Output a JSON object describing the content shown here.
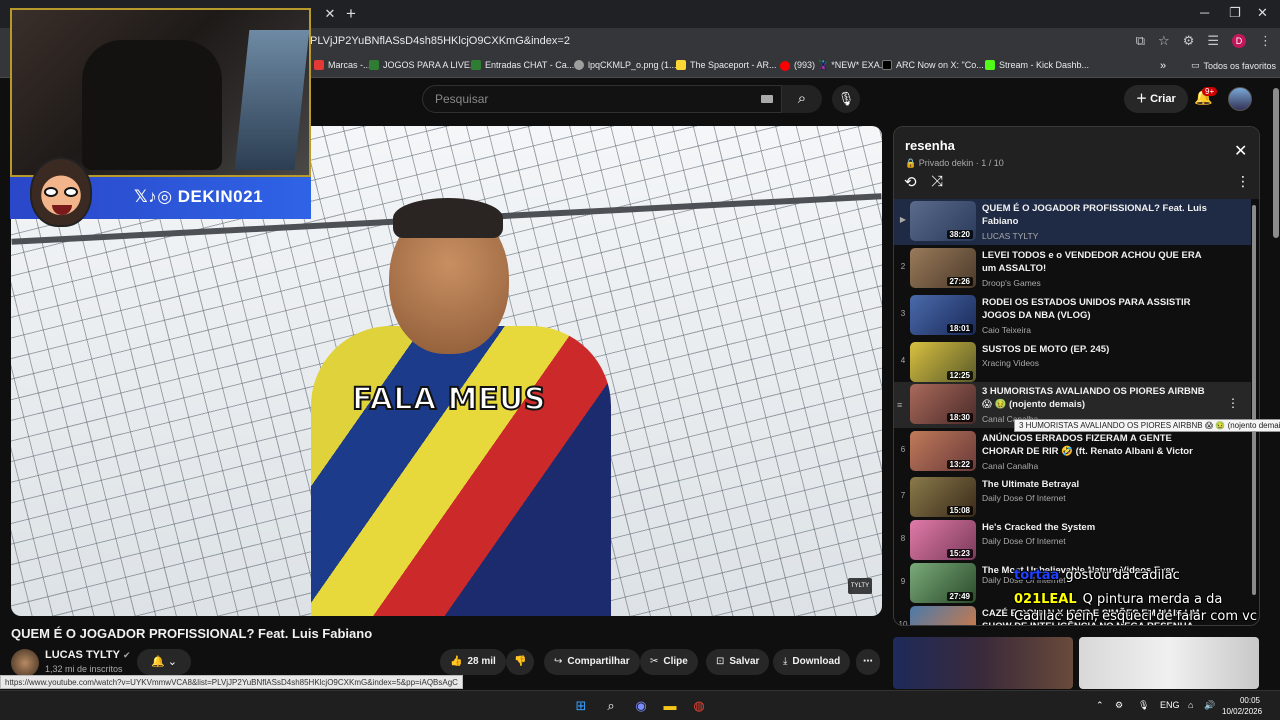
{
  "browser": {
    "url": "PLVjJP2YuBNflASsD4sh85HKlcjO9CXKmG&index=2",
    "bookmarks": [
      {
        "label": "Marcas -...",
        "color": "#e53935"
      },
      {
        "label": "JOGOS PARA A LIVE...",
        "color": "#2e7d32"
      },
      {
        "label": "Entradas CHAT - Ca...",
        "color": "#2e7d32"
      },
      {
        "label": "lpqCKMLP_o.png (1...",
        "color": "#9e9e9e"
      },
      {
        "label": "The Spaceport - AR...",
        "color": "#fdd835"
      },
      {
        "label": "(993) 🦹 *NEW* EXA...",
        "color": "#ff0000"
      },
      {
        "label": "ARC Now on X: \"Co...",
        "color": "#000000"
      },
      {
        "label": "Stream - Kick Dashb...",
        "color": "#53fc18"
      }
    ],
    "all_bookmarks": "Todos os favoritos",
    "profile_initial": "D",
    "status_url": "https://www.youtube.com/watch?v=UYKVmmwVCA8&list=PLVjJP2YuBNflASsD4sh85HKlcjO9CXKmG&index=5&pp=iAQBsAgC"
  },
  "youtube_header": {
    "search_placeholder": "Pesquisar",
    "create_label": "Criar",
    "notif_badge": "9+"
  },
  "overlay": {
    "social_handle": "DEKIN021",
    "social_icons": "𝕏♪◎"
  },
  "video": {
    "caption": "FALA MEUS",
    "watermark": "TYLTY",
    "title": "QUEM É O JOGADOR PROFISSIONAL? Feat. Luis Fabiano",
    "channel": "LUCAS TYLTY",
    "subscribers": "1,32 mi de inscritos",
    "likes": "28 mil",
    "share": "Compartilhar",
    "clip": "Clipe",
    "save": "Salvar",
    "download": "Download"
  },
  "playlist": {
    "title": "resenha",
    "meta": "Privado dekin · 1 / 10",
    "items": [
      {
        "index": "▶",
        "title": "QUEM É O JOGADOR PROFISSIONAL? Feat. Luis Fabiano",
        "channel": "LUCAS TYLTY",
        "duration": "38:20",
        "thumb": "#5a6b8c"
      },
      {
        "index": "2",
        "title": "LEVEI TODOS e o VENDEDOR ACHOU QUE ERA um ASSALTO!",
        "channel": "Droop's Games",
        "duration": "27:26",
        "thumb": "#7a5a3a"
      },
      {
        "index": "3",
        "title": "RODEI OS ESTADOS UNIDOS PARA ASSISTIR JOGOS DA NBA (VLOG)",
        "channel": "Caio Teixeira",
        "duration": "18:01",
        "thumb": "#3a5a9a"
      },
      {
        "index": "4",
        "title": "SUSTOS DE MOTO (EP. 245)",
        "channel": "Xracing Videos",
        "duration": "12:25",
        "thumb": "#b8a030"
      },
      {
        "index": "",
        "title": "3 HUMORISTAS AVALIANDO OS PIORES AIRBNB 😱 🤢 (nojento demais)",
        "channel": "Canal Canalha",
        "duration": "18:30",
        "thumb": "#8a4a3a"
      },
      {
        "index": "6",
        "title": "ANÚNCIOS ERRADOS FIZERAM A GENTE CHORAR DE RIR 🤣 (ft. Renato Albani & Victor Sarro)",
        "channel": "Canal Canalha",
        "duration": "13:22",
        "thumb": "#a05a4a"
      },
      {
        "index": "7",
        "title": "The Ultimate Betrayal",
        "channel": "Daily Dose Of Internet",
        "duration": "15:08",
        "thumb": "#6a5a3a"
      },
      {
        "index": "8",
        "title": "He's Cracked the System",
        "channel": "Daily Dose Of Internet",
        "duration": "15:23",
        "thumb": "#c85a8a"
      },
      {
        "index": "9",
        "title": "The Most Unbelievable Nature Videos Ever",
        "channel": "Daily Dose Of Internet",
        "duration": "27:49",
        "thumb": "#5a7a5a"
      },
      {
        "index": "10",
        "title": "CAZÉ E DONAN X IGOR E SIMÕES EM MAIS UM SHOW DE INTELIGÊNCIA NO MEGA RESENHA",
        "channel": "",
        "duration": "",
        "thumb": "#3a6a9a"
      }
    ],
    "tooltip": "3 HUMORISTAS AVALIANDO OS PIORES AIRBNB 😱 🤢 (nojento demais)"
  },
  "chat": [
    {
      "user": "tortaa",
      "user_color": "#1e40ff",
      "message": "gostou da cadilac"
    },
    {
      "user": "021LEAL",
      "user_color": "#ffff00",
      "message": "Q pintura merda a da"
    },
    {
      "user": "",
      "user_color": "#ffffff",
      "message": "Cadilac bein, esqueci de falar com vc"
    }
  ],
  "taskbar": {
    "language": "ENG",
    "time": "00:05",
    "date": "10/02/2026"
  }
}
